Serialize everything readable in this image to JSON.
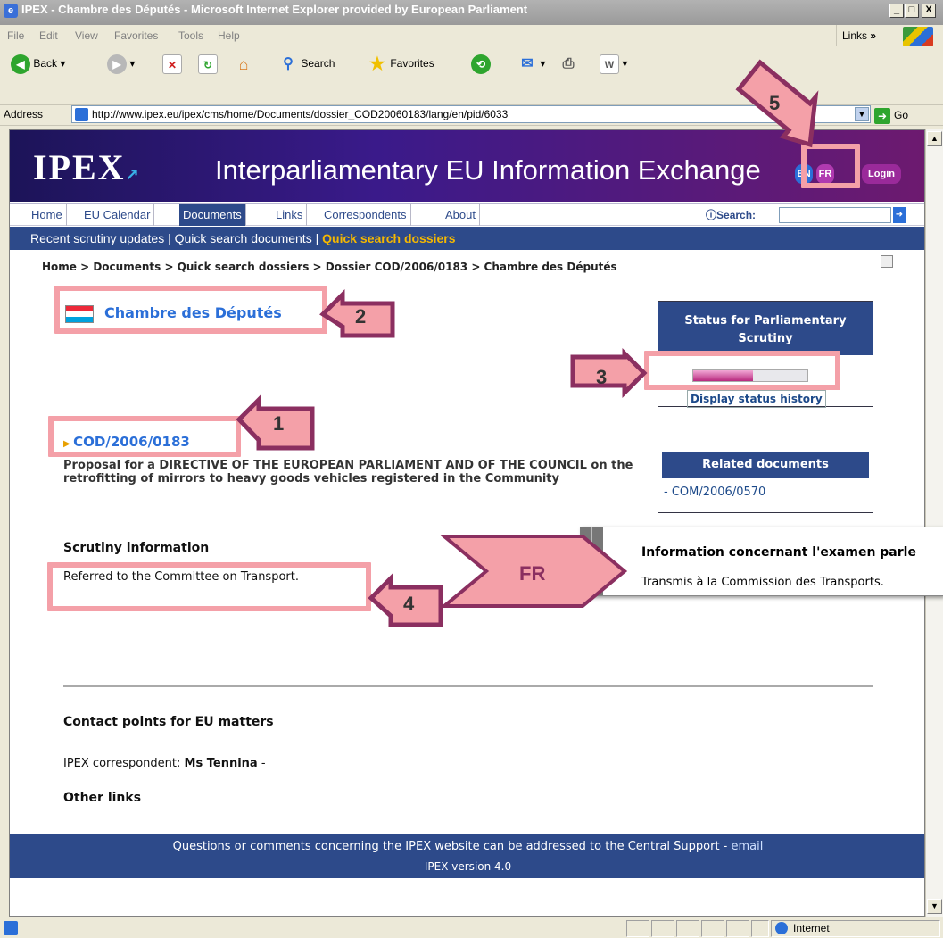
{
  "window": {
    "title": "IPEX - Chambre des Députés - Microsoft Internet Explorer provided by European Parliament",
    "controls": {
      "minimize": "_",
      "maximize": "□",
      "close": "X"
    }
  },
  "menu": [
    "File",
    "Edit",
    "View",
    "Favorites",
    "Tools",
    "Help"
  ],
  "links_label": "Links",
  "links_chevron": "»",
  "toolbar": {
    "back": "Back",
    "search": "Search",
    "favorites": "Favorites",
    "dropdown": "▾"
  },
  "address": {
    "label": "Address",
    "url": "http://www.ipex.eu/ipex/cms/home/Documents/dossier_COD20060183/lang/en/pid/6033",
    "go": "Go"
  },
  "site": {
    "logo": "IPEX",
    "title": "Interparliamentary EU Information Exchange",
    "lang_en": "EN",
    "lang_fr": "FR",
    "login": "Login"
  },
  "nav": {
    "items": [
      "Home",
      "EU Calendar",
      "Documents",
      "Links",
      "Correspondents",
      "About"
    ],
    "active": "Documents",
    "search_label": "Search:"
  },
  "subnav": {
    "recent": "Recent scrutiny updates",
    "sep": "|",
    "quick_docs": "Quick search documents",
    "quick_dossiers": "Quick search dossiers"
  },
  "breadcrumb": "Home  >  Documents  >  Quick search dossiers  >  Dossier COD/2006/0183  >  Chambre des Députés",
  "parliament": {
    "name": "Chambre des Députés",
    "flag_colors": [
      "#ed2939",
      "#ffffff",
      "#00a1de"
    ]
  },
  "status": {
    "header": "Status for Parliamentary Scrutiny",
    "progress": 0.52,
    "history_link": "Display status history"
  },
  "related": {
    "header": "Related documents",
    "link": "- COM/2006/0570"
  },
  "dossier": {
    "code": "COD/2006/0183",
    "description": "Proposal for a DIRECTIVE OF THE EUROPEAN PARLIAMENT AND OF THE COUNCIL on the retrofitting of mirrors to heavy goods vehicles registered in the Community"
  },
  "scrutiny": {
    "heading": "Scrutiny information",
    "text": "Referred to the Committee on Transport."
  },
  "fr_panel": {
    "heading": "Information concernant l'examen parle",
    "text": "Transmis à la Commission des Transports."
  },
  "contact": {
    "heading": "Contact points for EU matters",
    "label": "IPEX correspondent: ",
    "name": "Ms Tennina",
    "suffix": " -"
  },
  "other_links": "Other links",
  "footer": {
    "line1": "Questions or comments concerning the IPEX website can be addressed to the Central Support - ",
    "email": "email",
    "version": "IPEX version 4.0"
  },
  "statusbar": {
    "zone": "Internet"
  },
  "annotations": {
    "n1": "1",
    "n2": "2",
    "n3": "3",
    "n4": "4",
    "n5": "5",
    "fr": "FR",
    "color": "#f4a0a8",
    "arrow_color": "#8b2f60"
  }
}
